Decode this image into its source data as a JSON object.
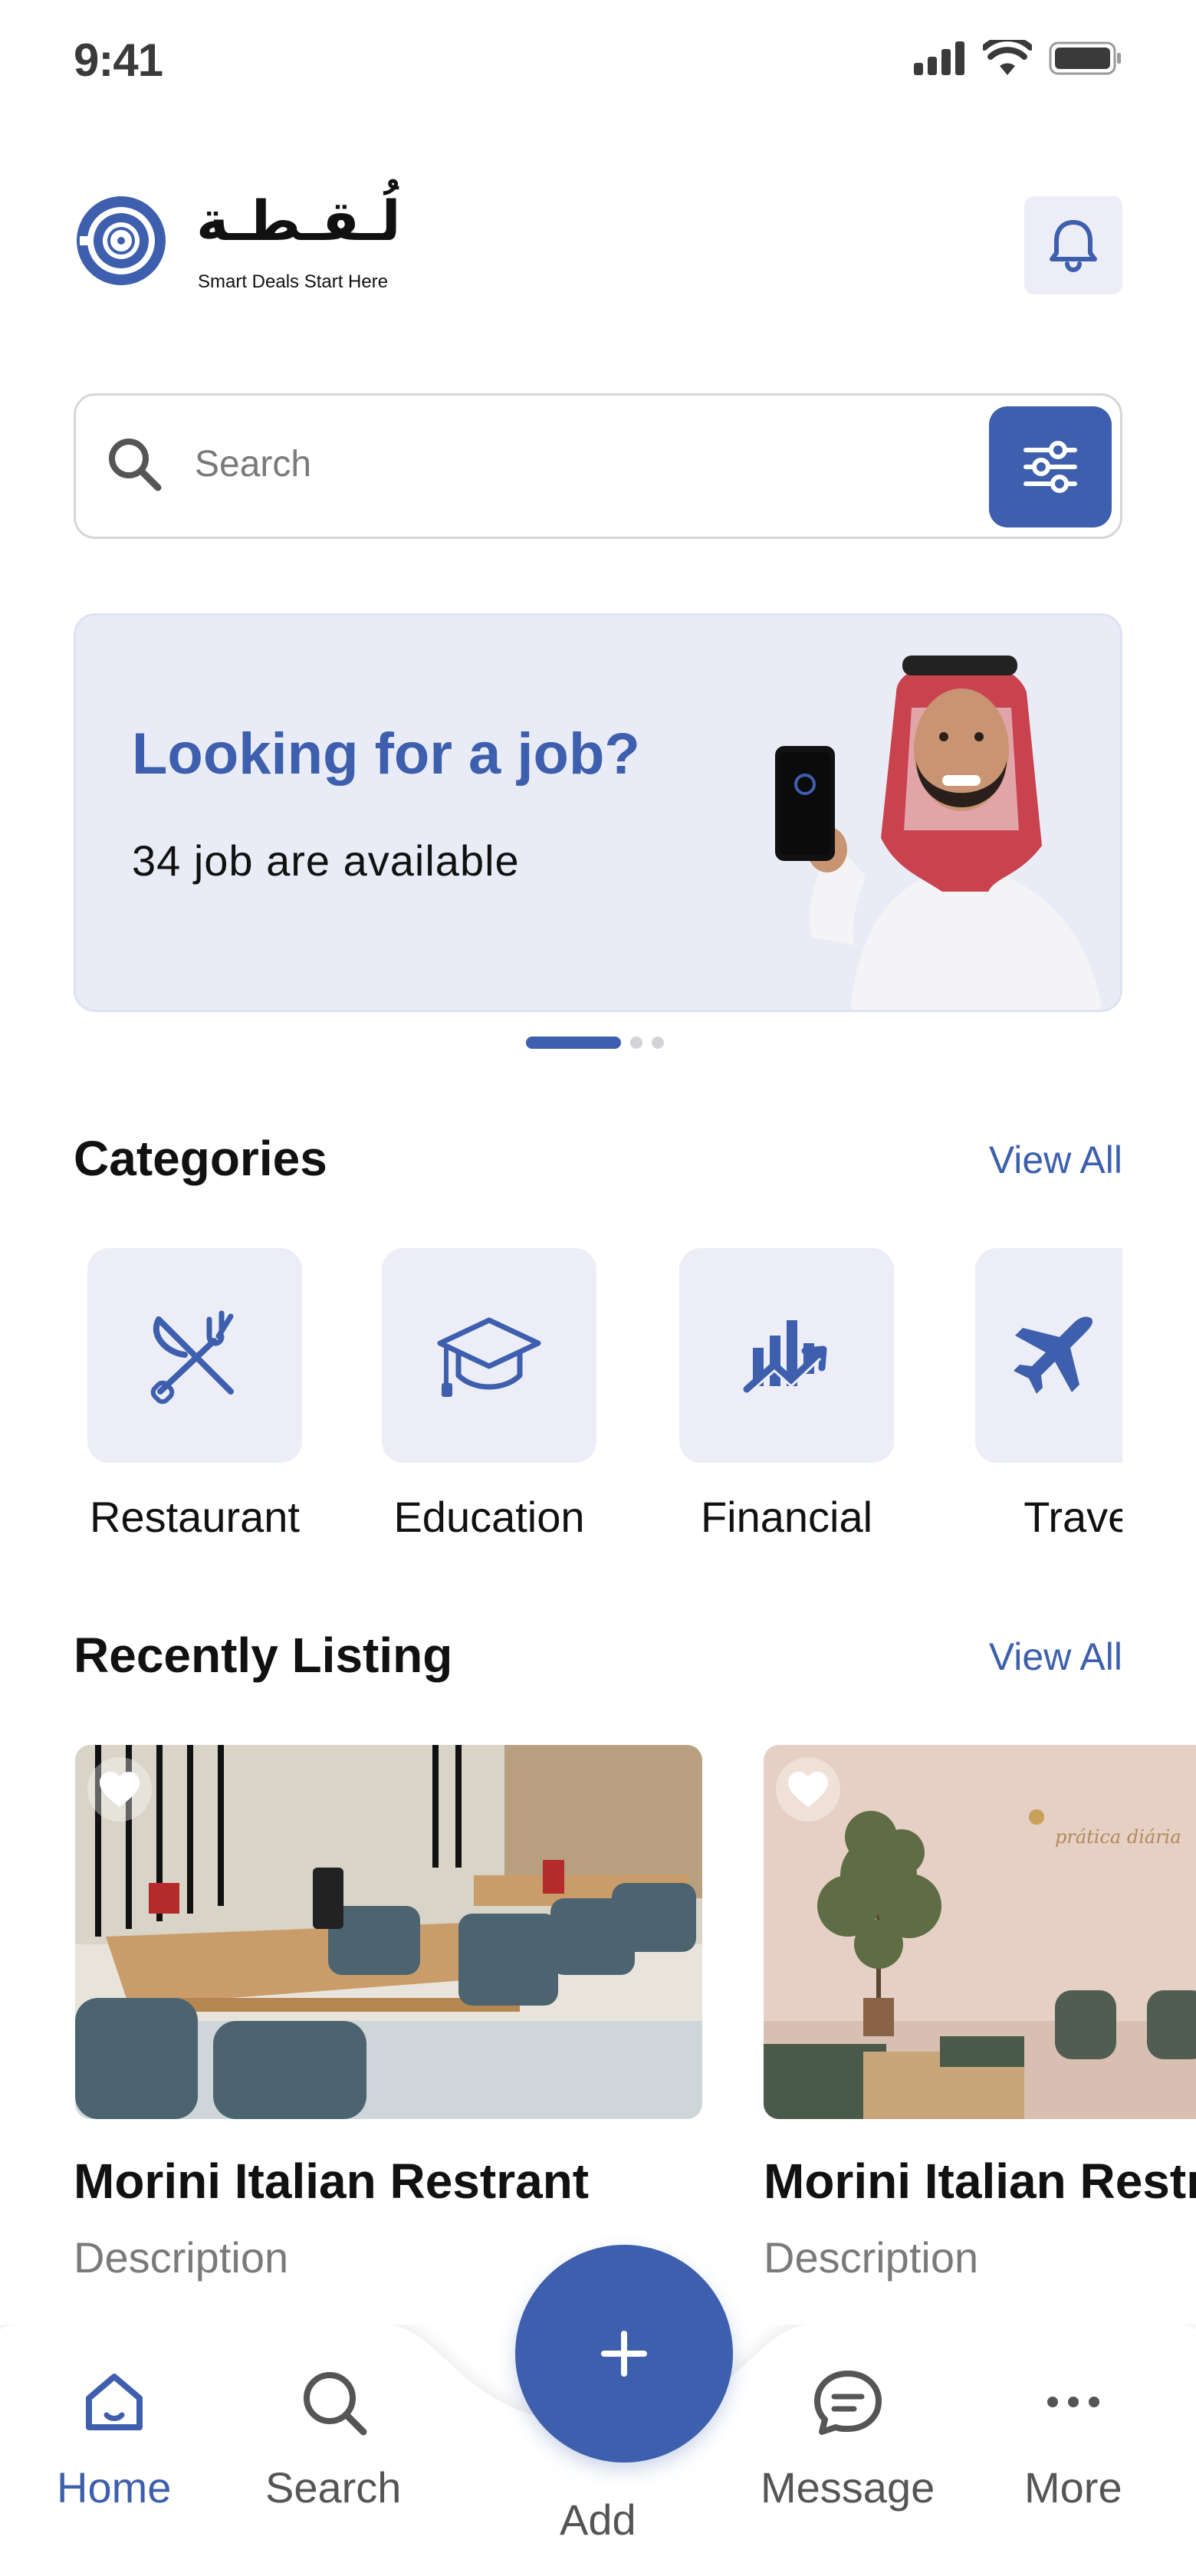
{
  "status_bar": {
    "time": "9:41"
  },
  "brand": {
    "name_ar": "لُـقـطـة",
    "tagline": "Smart Deals Start Here"
  },
  "search": {
    "placeholder": "Search"
  },
  "banner": {
    "title": "Looking for a job?",
    "subtitle": "34 job are available"
  },
  "categories": {
    "title": "Categories",
    "view_all": "View All",
    "items": [
      {
        "label": "Restaurant",
        "icon": "fork-knife-icon"
      },
      {
        "label": "Education",
        "icon": "graduation-cap-icon"
      },
      {
        "label": "Financial",
        "icon": "chart-growth-icon"
      },
      {
        "label": "Travel",
        "icon": "airplane-icon"
      }
    ]
  },
  "recent": {
    "title": "Recently Listing",
    "view_all": "View All",
    "cards": [
      {
        "title": "Morini Italian Restrant",
        "description": "Description",
        "wall_text": ""
      },
      {
        "title": "Morini Italian Restrant",
        "description": "Description",
        "wall_text": "prática diária"
      }
    ]
  },
  "bottom_nav": {
    "items": [
      {
        "label": "Home",
        "icon": "home-icon",
        "active": true
      },
      {
        "label": "Search",
        "icon": "search-icon",
        "active": false
      },
      {
        "label": "Add",
        "icon": "plus-icon",
        "active": false
      },
      {
        "label": "Message",
        "icon": "message-icon",
        "active": false
      },
      {
        "label": "More",
        "icon": "more-icon",
        "active": false
      }
    ]
  },
  "colors": {
    "primary": "#3d5fad",
    "tile_bg": "#ecedf7",
    "muted_text": "#7a7a7a"
  }
}
